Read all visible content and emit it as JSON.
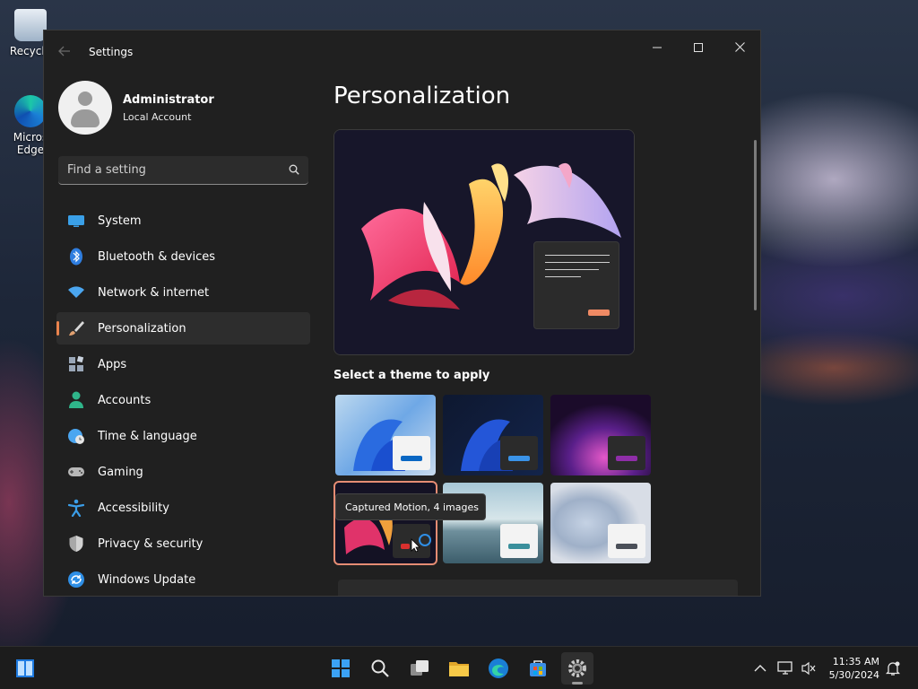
{
  "desktop": {
    "icons": [
      {
        "label": "Recycle",
        "icon": "recycle-bin-icon"
      },
      {
        "label": "Micros\nEdge",
        "icon": "edge-icon"
      }
    ]
  },
  "window": {
    "title": "Settings",
    "controls": {
      "minimize": "–",
      "maximize": "□",
      "close": "✕"
    }
  },
  "profile": {
    "name": "Administrator",
    "account_type": "Local Account"
  },
  "search": {
    "placeholder": "Find a setting"
  },
  "sidebar": {
    "items": [
      {
        "label": "System",
        "icon": "monitor-icon",
        "color": "#3aa0e8"
      },
      {
        "label": "Bluetooth & devices",
        "icon": "bluetooth-icon",
        "color": "#3b8ee8"
      },
      {
        "label": "Network & internet",
        "icon": "wifi-icon",
        "color": "#4ba6f0"
      },
      {
        "label": "Personalization",
        "icon": "brush-icon",
        "color": "#e0a070",
        "active": true
      },
      {
        "label": "Apps",
        "icon": "apps-icon",
        "color": "#9aa7b8"
      },
      {
        "label": "Accounts",
        "icon": "person-icon",
        "color": "#2fb58a"
      },
      {
        "label": "Time & language",
        "icon": "globe-clock-icon",
        "color": "#4ba6f0"
      },
      {
        "label": "Gaming",
        "icon": "gamepad-icon",
        "color": "#b8b8b8"
      },
      {
        "label": "Accessibility",
        "icon": "accessibility-icon",
        "color": "#3b9ee8"
      },
      {
        "label": "Privacy & security",
        "icon": "shield-icon",
        "color": "#a8a8a8"
      },
      {
        "label": "Windows Update",
        "icon": "update-icon",
        "color": "#3b9ee8"
      }
    ]
  },
  "main": {
    "title": "Personalization",
    "theme_heading": "Select a theme to apply",
    "tooltip": "Captured Motion, 4 images",
    "accent_color": "#e58c73"
  },
  "taskbar": {
    "time": "11:35 AM",
    "date": "5/30/2024",
    "apps": [
      "start-icon",
      "search-icon",
      "task-view-icon",
      "file-explorer-icon",
      "edge-icon",
      "store-icon",
      "settings-icon"
    ]
  }
}
